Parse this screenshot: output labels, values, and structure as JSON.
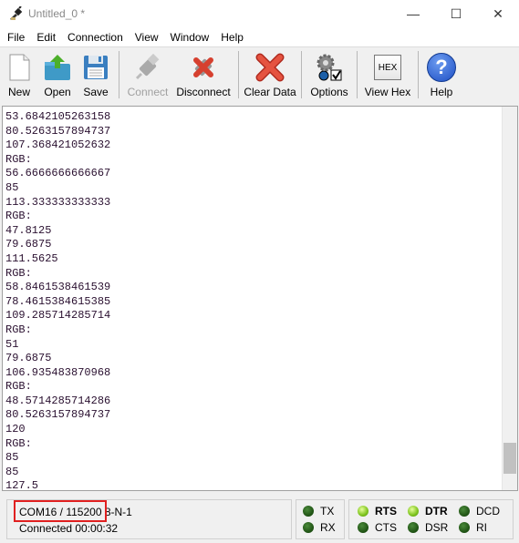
{
  "window": {
    "title": "Untitled_0 *",
    "minimize": "—",
    "maximize": "☐",
    "close": "✕"
  },
  "menu": [
    "File",
    "Edit",
    "Connection",
    "View",
    "Window",
    "Help"
  ],
  "toolbar": [
    {
      "label": "New",
      "icon": "new-file-icon",
      "enabled": true
    },
    {
      "label": "Open",
      "icon": "open-folder-icon",
      "enabled": true
    },
    {
      "label": "Save",
      "icon": "floppy-disk-icon",
      "enabled": true
    },
    {
      "label": "Connect",
      "icon": "usb-plug-icon",
      "enabled": false
    },
    {
      "label": "Disconnect",
      "icon": "usb-disconnect-icon",
      "enabled": true
    },
    {
      "label": "Clear Data",
      "icon": "red-x-icon",
      "enabled": true
    },
    {
      "label": "Options",
      "icon": "gears-options-icon",
      "enabled": true
    },
    {
      "label": "View Hex",
      "icon": "hex-icon",
      "icon_text": "HEX",
      "enabled": true
    },
    {
      "label": "Help",
      "icon": "question-help-icon",
      "icon_text": "?",
      "enabled": true
    }
  ],
  "output_lines": [
    "53.6842105263158",
    "80.5263157894737",
    "107.368421052632",
    "RGB:",
    "56.6666666666667",
    "85",
    "113.333333333333",
    "RGB:",
    "47.8125",
    "79.6875",
    "111.5625",
    "RGB:",
    "58.8461538461539",
    "78.4615384615385",
    "109.285714285714",
    "RGB:",
    "51",
    "79.6875",
    "106.935483870968",
    "RGB:",
    "48.5714285714286",
    "80.5263157894737",
    "120",
    "RGB:",
    "85",
    "85",
    "127.5"
  ],
  "status": {
    "port": "COM16 / 115200 8-N-1",
    "connection": "Connected 00:00:32",
    "signals": [
      {
        "name": "TX",
        "on": false,
        "bold": false
      },
      {
        "name": "RX",
        "on": false,
        "bold": false
      },
      {
        "name": "RTS",
        "on": true,
        "bold": true
      },
      {
        "name": "CTS",
        "on": false,
        "bold": false
      },
      {
        "name": "DTR",
        "on": true,
        "bold": true
      },
      {
        "name": "DSR",
        "on": false,
        "bold": false
      },
      {
        "name": "DCD",
        "on": false,
        "bold": false
      },
      {
        "name": "RI",
        "on": false,
        "bold": false
      }
    ],
    "highlight_color": "#e02020"
  }
}
